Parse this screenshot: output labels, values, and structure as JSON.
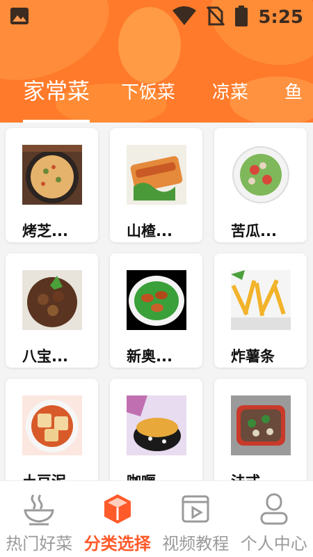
{
  "status_bar": {
    "time": "5:25",
    "icons": [
      "image-icon",
      "wifi-icon",
      "no-sim-icon",
      "battery-icon"
    ]
  },
  "tabs": [
    {
      "label": "家常菜",
      "active": true
    },
    {
      "label": "下饭菜",
      "active": false
    },
    {
      "label": "凉菜",
      "active": false
    },
    {
      "label": "鱼",
      "active": false
    }
  ],
  "cards": [
    {
      "title": "烤芝..."
    },
    {
      "title": "山楂..."
    },
    {
      "title": "苦瓜..."
    },
    {
      "title": "八宝..."
    },
    {
      "title": "新奥..."
    },
    {
      "title": "炸薯条"
    },
    {
      "title": "土豆泥"
    },
    {
      "title": "咖喱"
    },
    {
      "title": "法式"
    }
  ],
  "bottom_nav": [
    {
      "label": "热门好菜",
      "icon": "bowl-icon",
      "active": false
    },
    {
      "label": "分类选择",
      "icon": "cube-icon",
      "active": true
    },
    {
      "label": "视频教程",
      "icon": "video-icon",
      "active": false
    },
    {
      "label": "个人中心",
      "icon": "person-icon",
      "active": false
    }
  ],
  "colors": {
    "brand": "#ff7a2a",
    "active_nav": "#ff5a2a",
    "inactive_nav": "#9a9a9a"
  }
}
